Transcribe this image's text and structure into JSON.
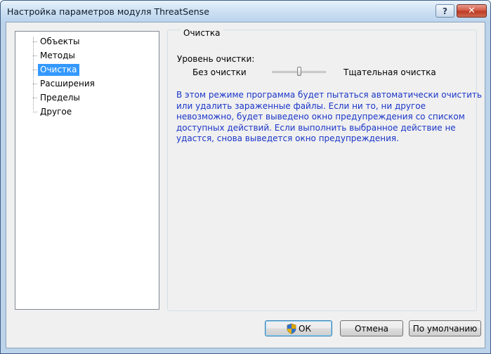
{
  "window": {
    "title": "Настройка параметров модуля ThreatSense",
    "help_glyph": "?",
    "close_glyph": "✕"
  },
  "tree": {
    "items": [
      {
        "label": "Объекты"
      },
      {
        "label": "Методы"
      },
      {
        "label": "Очистка",
        "selected": true
      },
      {
        "label": "Расширения"
      },
      {
        "label": "Пределы"
      },
      {
        "label": "Другое"
      }
    ]
  },
  "group": {
    "title": "Очистка",
    "level_label": "Уровень очистки:",
    "slider": {
      "min_label": "Без очистки",
      "max_label": "Тщательная очистка",
      "level": 0.5
    },
    "description": "В этом режиме программа будет пытаться автоматически очистить или удалить зараженные файлы. Если ни то, ни другое невозможно, будет выведено окно предупреждения со списком доступных действий. Если выполнить выбранное действие не удастся, снова выведется окно предупреждения."
  },
  "buttons": {
    "ok": "ОК",
    "cancel": "Отмена",
    "default": "По умолчанию"
  },
  "colors": {
    "description_text": "#1a35c8",
    "selection": "#3399ff",
    "close_button": "#c7402b"
  },
  "icons": {
    "ok_button_icon": "shield-icon"
  }
}
